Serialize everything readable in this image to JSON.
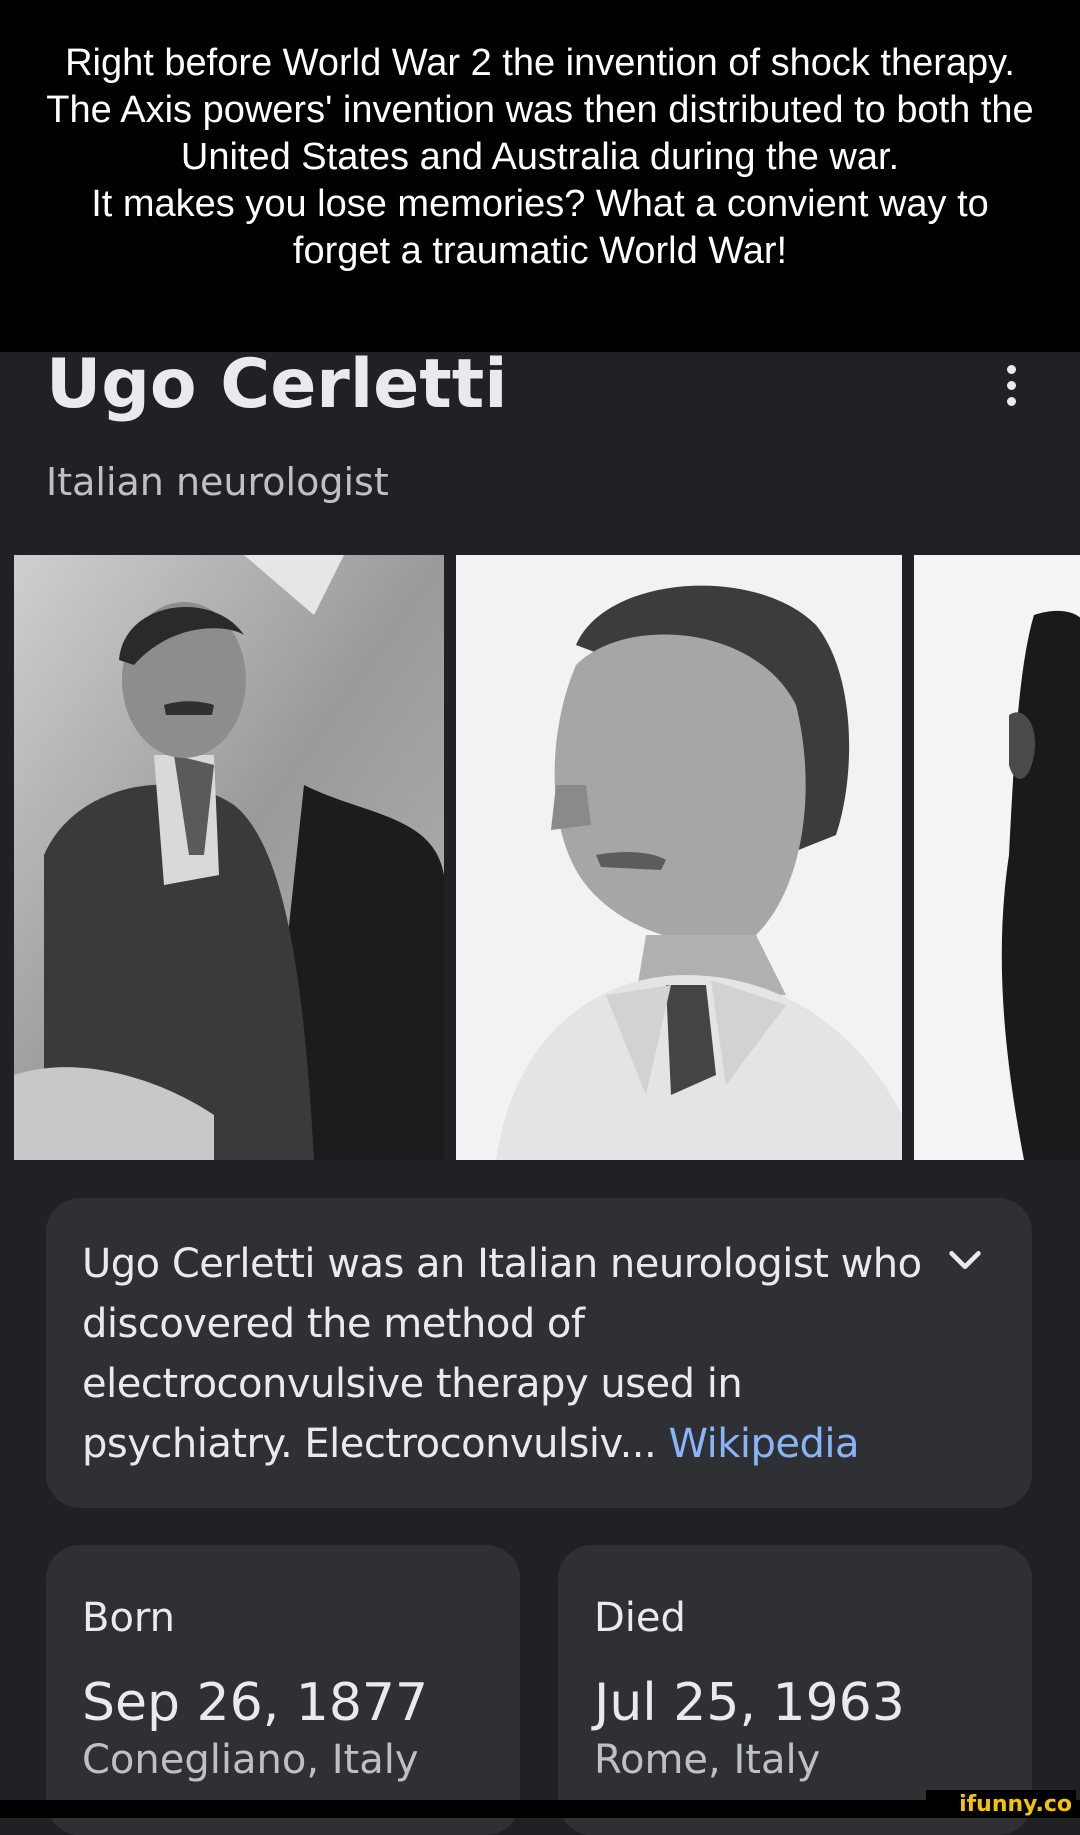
{
  "caption": {
    "lines": [
      "Right before World War 2 the invention of shock therapy.",
      "The Axis powers' invention was then distributed to both the United States and Australia during the war.",
      "It makes you lose memories? What a convient way to forget a traumatic World War!"
    ]
  },
  "knowledge_panel": {
    "title": "Ugo Cerletti",
    "subtitle": "Italian neurologist",
    "more_icon": "more-vert-icon",
    "summary": {
      "text": "Ugo Cerletti was an Italian neurologist who discovered the method of electroconvulsive therapy used in psychiatry. Electroconvulsiv",
      "ellipsis": "...",
      "source_link": "Wikipedia",
      "expand_icon": "chevron-down-icon"
    },
    "facts": {
      "born": {
        "label": "Born",
        "date": "Sep 26, 1877",
        "place": "Conegliano, Italy"
      },
      "died": {
        "label": "Died",
        "date": "Jul 25, 1963",
        "place": "Rome, Italy"
      }
    }
  },
  "watermark": "ifunny.co",
  "colors": {
    "caption_bg": "#000000",
    "page_bg": "#202124",
    "card_bg": "#2e3033",
    "text_primary": "#e8eaed",
    "text_secondary": "#bdc1c6",
    "link": "#8ab4f8",
    "watermark": "#f5c400"
  }
}
